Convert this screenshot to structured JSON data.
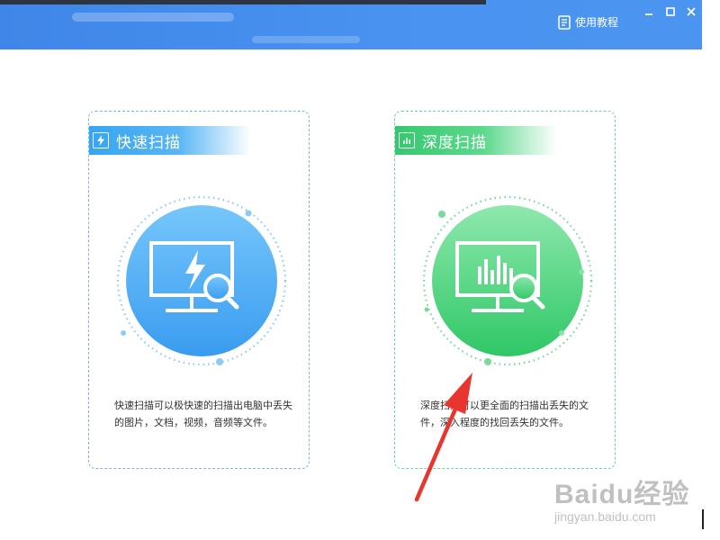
{
  "titlebar": {
    "help_label": "使用教程"
  },
  "cards": {
    "quick": {
      "title": "快速扫描",
      "description": "快速扫描可以极快速的扫描出电脑中丢失的图片，文档，视频，音频等文件。",
      "accent": "#36a5f2"
    },
    "deep": {
      "title": "深度扫描",
      "description": "深度扫描可以更全面的扫描出丢失的文件，深入程度的找回丢失的文件。",
      "accent": "#34c86e"
    }
  },
  "watermark": {
    "main": "Baidu经验",
    "sub": "jingyan.baidu.com"
  },
  "icons": {
    "help": "book-icon",
    "minimize": "minimize-icon",
    "maximize": "maximize-icon",
    "close": "close-icon",
    "quick_scan": "lightning-monitor-icon",
    "deep_scan": "bar-chart-monitor-icon"
  }
}
